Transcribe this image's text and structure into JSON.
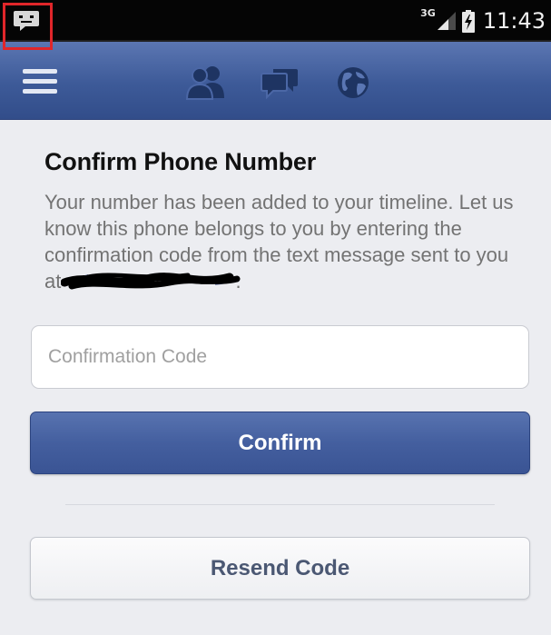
{
  "status_bar": {
    "network_type": "3G",
    "time": "11:43",
    "notification_icon": "chat-bubble-icon",
    "highlight_color": "#e0262a"
  },
  "header": {
    "icons": [
      "menu-icon",
      "friends-icon",
      "messages-icon",
      "globe-icon"
    ],
    "color": "#3d5a98"
  },
  "page": {
    "title": "Confirm Phone Number",
    "description_before": "Your number has been added to your timeline. Let us know this phone belongs to you by entering the confirmation code from the text message sent to you at",
    "description_after": "."
  },
  "form": {
    "code_placeholder": "Confirmation Code",
    "code_value": "",
    "confirm_label": "Confirm",
    "resend_label": "Resend Code"
  }
}
